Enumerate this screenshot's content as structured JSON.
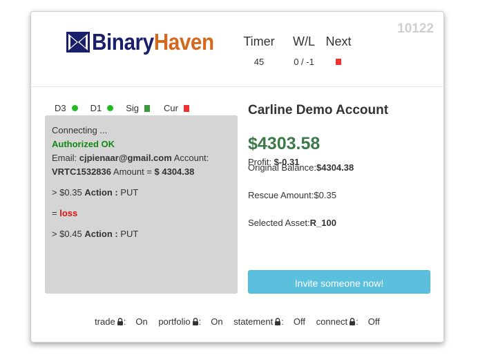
{
  "header": {
    "session_id": "10122",
    "logo": {
      "part1": "Binary",
      "part2": "Haven"
    },
    "timer": {
      "label": "Timer",
      "value": "45"
    },
    "wl": {
      "label": "W/L",
      "value": "0 / -1"
    },
    "next": {
      "label": "Next",
      "indicator_color": "#ee3333"
    }
  },
  "status": {
    "d3": {
      "label": "D3",
      "color": "#1fbb1f"
    },
    "d1": {
      "label": "D1",
      "color": "#1fbb1f"
    },
    "sig": {
      "label": "Sig",
      "color": "#3a9a3a"
    },
    "cur": {
      "label": "Cur",
      "color": "#ee3333"
    }
  },
  "log": {
    "connecting": "Connecting ...",
    "authorized": "Authorized OK",
    "email_label": "Email: ",
    "email": "cjpienaar@gmail.com",
    "account_label": " Account:",
    "account": "VRTC1532836",
    "amount_label": " Amount = ",
    "amount": "$ 4304.38",
    "entries": [
      {
        "prefix": "> $0.35 ",
        "action_label": "Action :",
        "action": " PUT"
      },
      {
        "result_prefix": "= ",
        "result": "loss"
      },
      {
        "prefix": "> $0.45 ",
        "action_label": "Action :",
        "action": " PUT"
      }
    ]
  },
  "account": {
    "title": "Carline Demo Account",
    "balance": "$4303.58",
    "profit_label": "Profit: ",
    "profit": "$-0.31",
    "original_balance_label": "Original Balance:",
    "original_balance": "$4304.38",
    "rescue_amount_label": "Rescue Amount:",
    "rescue_amount": "$0.35",
    "selected_asset_label": "Selected Asset:",
    "selected_asset": "R_100",
    "invite_button": "Invite someone now!"
  },
  "permissions": [
    {
      "name": "trade",
      "icon": "lock-icon",
      "value": "On"
    },
    {
      "name": "portfolio",
      "icon": "lock-icon",
      "value": "On"
    },
    {
      "name": "statement",
      "icon": "lock-icon",
      "value": "Off"
    },
    {
      "name": "connect",
      "icon": "lock-icon",
      "value": "Off"
    }
  ]
}
